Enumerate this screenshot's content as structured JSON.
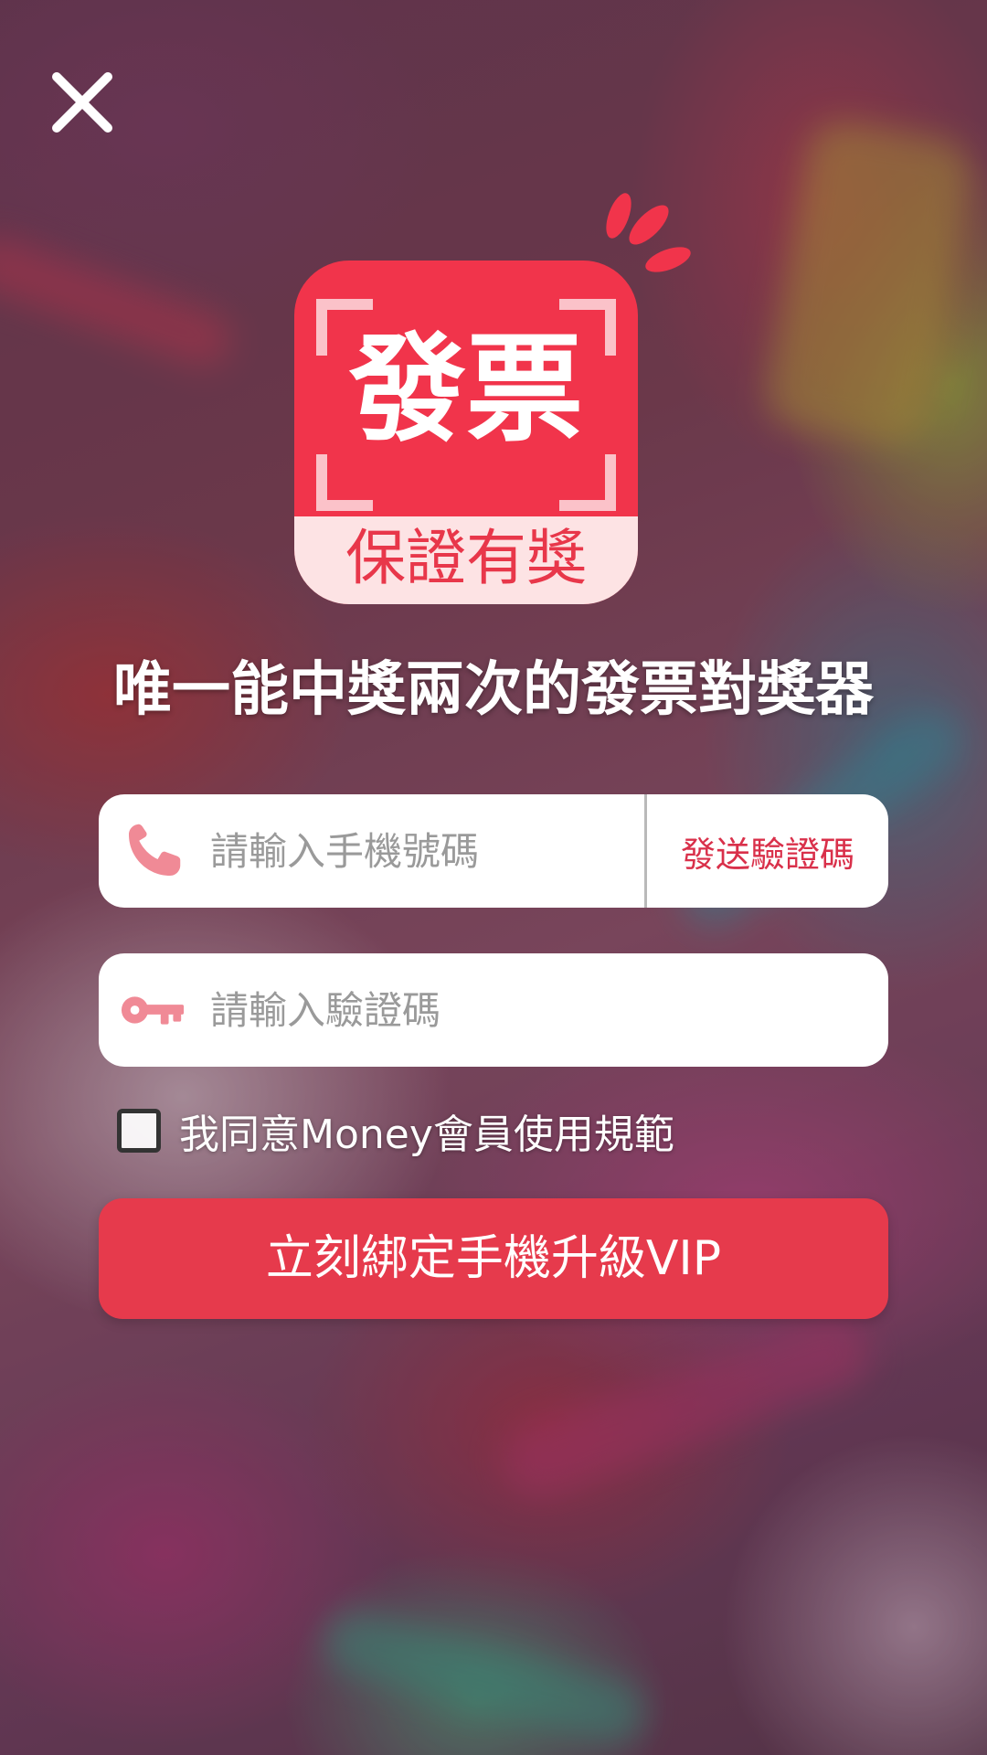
{
  "app": {
    "logo_title": "發票",
    "logo_subtitle": "保證有獎"
  },
  "headline": "唯一能中獎兩次的發票對獎器",
  "phone_field": {
    "placeholder": "請輸入手機號碼",
    "value": "",
    "icon": "phone-icon",
    "send_code_label": "發送驗證碼"
  },
  "code_field": {
    "placeholder": "請輸入驗證碼",
    "value": "",
    "icon": "key-icon"
  },
  "agreement": {
    "label": "我同意Money會員使用規範",
    "checked": false
  },
  "cta": {
    "label": "立刻綁定手機升級VIP"
  },
  "colors": {
    "brand_red": "#f1344b",
    "cta_red": "#e63a4c",
    "icon_pink": "#f08a96",
    "link_red": "#d9304a",
    "logo_band": "#fde3e4"
  }
}
